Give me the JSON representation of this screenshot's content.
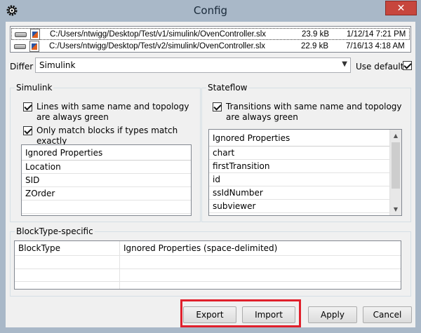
{
  "window": {
    "title": "Config",
    "close_glyph": "✕"
  },
  "files": [
    {
      "path": "C:/Users/ntwigg/Desktop/Test/v1/simulink/OvenController.slx",
      "size": "23.9 kB",
      "date": "1/12/14 7:21 PM"
    },
    {
      "path": "C:/Users/ntwigg/Desktop/Test/v2/simulink/OvenController.slx",
      "size": "22.9 kB",
      "date": "7/16/13 4:18 AM"
    }
  ],
  "differ": {
    "label": "Differ",
    "value": "Simulink",
    "use_default_label": "Use default",
    "use_default_checked": true
  },
  "simulink": {
    "title": "Simulink",
    "option1": "Lines with same name and topology are always green",
    "option2": "Only match blocks if types match exactly",
    "list_header": "Ignored Properties",
    "items": [
      "Location",
      "SID",
      "ZOrder"
    ]
  },
  "stateflow": {
    "title": "Stateflow",
    "option1": "Transitions with same name and topology are always green",
    "list_header": "Ignored Properties",
    "items": [
      "chart",
      "firstTransition",
      "id",
      "ssIdNumber",
      "subviewer"
    ]
  },
  "blocktype": {
    "title": "BlockType-specific",
    "col1": "BlockType",
    "col2": "Ignored Properties (space-delimited)"
  },
  "buttons": {
    "export": "Export",
    "import": "Import",
    "apply": "Apply",
    "cancel": "Cancel"
  },
  "colors": {
    "titlebar": "#a9b8c8",
    "close": "#c7463d",
    "highlight": "#e0202c"
  }
}
